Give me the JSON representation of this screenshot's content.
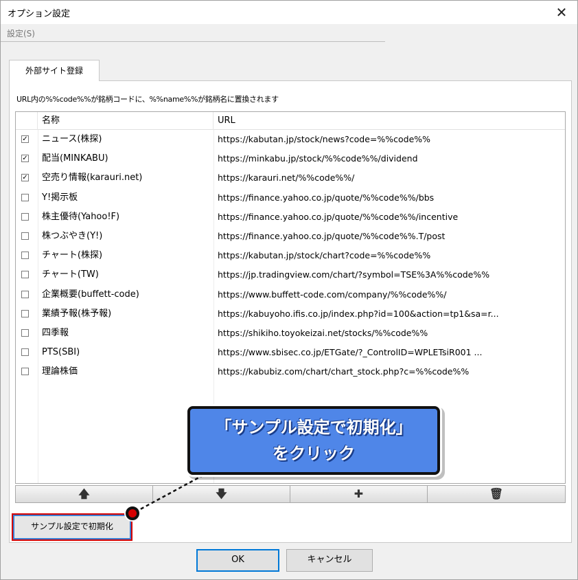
{
  "window": {
    "title": "オプション設定",
    "close_glyph": "✕"
  },
  "menu": {
    "settings_label": "設定(S)"
  },
  "tab": {
    "label": "外部サイト登録"
  },
  "description": "URL内の%%code%%が銘柄コードに、%%name%%が銘柄名に置換されます",
  "table": {
    "headers": [
      "",
      "名称",
      "URL"
    ],
    "rows": [
      {
        "checked": true,
        "check_glyph": "✓",
        "name": "ニュース(株探)",
        "url": "https://kabutan.jp/stock/news?code=%%code%%"
      },
      {
        "checked": true,
        "check_glyph": "✓",
        "name": "配当(MINKABU)",
        "url": "https://minkabu.jp/stock/%%code%%/dividend"
      },
      {
        "checked": true,
        "check_glyph": "✓",
        "name": "空売り情報(karauri.net)",
        "url": "https://karauri.net/%%code%%/"
      },
      {
        "checked": false,
        "check_glyph": "",
        "name": "Y!掲示板",
        "url": "https://finance.yahoo.co.jp/quote/%%code%%/bbs"
      },
      {
        "checked": false,
        "check_glyph": "",
        "name": "株主優待(Yahoo!F)",
        "url": "https://finance.yahoo.co.jp/quote/%%code%%/incentive"
      },
      {
        "checked": false,
        "check_glyph": "",
        "name": "株つぶやき(Y!)",
        "url": "https://finance.yahoo.co.jp/quote/%%code%%.T/post"
      },
      {
        "checked": false,
        "check_glyph": "",
        "name": "チャート(株探)",
        "url": "https://kabutan.jp/stock/chart?code=%%code%%"
      },
      {
        "checked": false,
        "check_glyph": "",
        "name": "チャート(TW)",
        "url": "https://jp.tradingview.com/chart/?symbol=TSE%3A%%code%%"
      },
      {
        "checked": false,
        "check_glyph": "",
        "name": "企業概要(buffett-code)",
        "url": "https://www.buffett-code.com/company/%%code%%/"
      },
      {
        "checked": false,
        "check_glyph": "",
        "name": "業績予報(株予報)",
        "url": "https://kabuyoho.ifis.co.jp/index.php?id=100&action=tp1&sa=r..."
      },
      {
        "checked": false,
        "check_glyph": "",
        "name": "四季報",
        "url": "https://shikiho.toyokeizai.net/stocks/%%code%%"
      },
      {
        "checked": false,
        "check_glyph": "",
        "name": "PTS(SBI)",
        "url": "https://www.sbisec.co.jp/ETGate/?_ControlID=WPLETsiR001 ..."
      },
      {
        "checked": false,
        "check_glyph": "",
        "name": "理論株価",
        "url": "https://kabubiz.com/chart/chart_stock.php?c=%%code%%"
      }
    ]
  },
  "toolbar": {
    "up": "🡅",
    "down": "🡇",
    "add": "✚",
    "delete": "🗑"
  },
  "buttons": {
    "sample": "サンプル設定で初期化",
    "ok": "OK",
    "cancel": "キャンセル"
  },
  "callout": {
    "line1": "「サンプル設定で初期化」",
    "line2": "をクリック"
  },
  "colors": {
    "callout_fill": "#4f86e8",
    "highlight_border": "#d40000"
  }
}
